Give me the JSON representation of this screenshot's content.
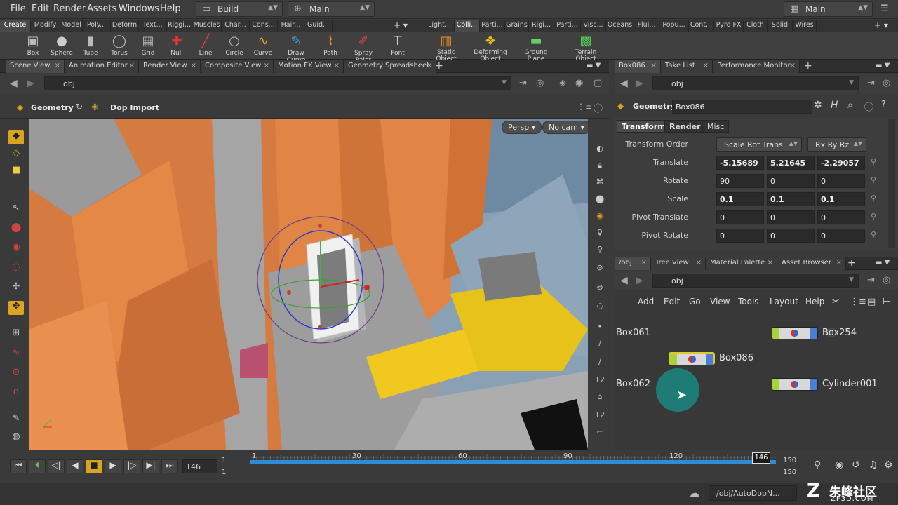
{
  "menubar": {
    "items": [
      "File",
      "Edit",
      "Render",
      "Assets",
      "Windows",
      "Help"
    ],
    "desktop_left": "Build",
    "desktop_mid": "Main",
    "desktop_right": "Main"
  },
  "shelf_tabs_left": [
    "Create",
    "Modify",
    "Model",
    "Poly...",
    "Deform",
    "Text...",
    "Riggi...",
    "Muscles",
    "Char...",
    "Cons...",
    "Hair...",
    "Guid..."
  ],
  "shelf_tabs_right": [
    "Light...",
    "Colli...",
    "Parti...",
    "Grains",
    "Rigi...",
    "Parti...",
    "Visc...",
    "Oceans",
    "Flui...",
    "Popu...",
    "Cont...",
    "Pyro FX",
    "Cloth",
    "Solid",
    "Wires"
  ],
  "shelf_tools_left": [
    {
      "label": "Box",
      "icon": "cube"
    },
    {
      "label": "Sphere",
      "icon": "sphere"
    },
    {
      "label": "Tube",
      "icon": "tube"
    },
    {
      "label": "Torus",
      "icon": "torus"
    },
    {
      "label": "Grid",
      "icon": "grid"
    },
    {
      "label": "Null",
      "icon": "null"
    },
    {
      "label": "Line",
      "icon": "line"
    },
    {
      "label": "Circle",
      "icon": "circle"
    },
    {
      "label": "Curve",
      "icon": "curve"
    },
    {
      "label": "Draw Curve",
      "icon": "draw-curve"
    },
    {
      "label": "Path",
      "icon": "path"
    },
    {
      "label": "Spray Paint",
      "icon": "spray"
    },
    {
      "label": "Font",
      "icon": "font"
    }
  ],
  "shelf_tools_right": [
    {
      "label": "Static Object",
      "icon": "static"
    },
    {
      "label": "Deforming Object",
      "icon": "deforming"
    },
    {
      "label": "Ground Plane",
      "icon": "ground"
    },
    {
      "label": "Terrain Object",
      "icon": "terrain"
    }
  ],
  "left_pane_tabs": [
    "Scene View",
    "Animation Editor",
    "Render View",
    "Composite View",
    "Motion FX View",
    "Geometry Spreadsheet"
  ],
  "left_path": "obj",
  "viewer_context": "Geometry",
  "viewer_tool": "Dop Import",
  "viewport_buttons": {
    "persp": "Persp",
    "cam": "No cam"
  },
  "right_top_tabs": [
    "Box086",
    "Take List",
    "Performance Monitor"
  ],
  "right_path": "obj",
  "node_type": "Geometry",
  "node_name": "Box086",
  "param_tabs": [
    "Transform",
    "Render",
    "Misc"
  ],
  "params": {
    "transform_order": {
      "label": "Transform Order",
      "value1": "Scale Rot Trans",
      "value2": "Rx Ry Rz"
    },
    "rows": [
      {
        "label": "Translate",
        "values": [
          "-5.15689",
          "5.21645",
          "-2.29057"
        ],
        "bold": true
      },
      {
        "label": "Rotate",
        "values": [
          "90",
          "0",
          "0"
        ],
        "bold": false
      },
      {
        "label": "Scale",
        "values": [
          "0.1",
          "0.1",
          "0.1"
        ],
        "bold": true
      },
      {
        "label": "Pivot Translate",
        "values": [
          "0",
          "0",
          "0"
        ],
        "bold": false
      },
      {
        "label": "Pivot Rotate",
        "values": [
          "0",
          "0",
          "0"
        ],
        "bold": false
      }
    ]
  },
  "network_tabs": [
    "/obj",
    "Tree View",
    "Material Palette",
    "Asset Browser"
  ],
  "network_path": "obj",
  "network_menu": [
    "Add",
    "Edit",
    "Go",
    "View",
    "Tools",
    "Layout",
    "Help"
  ],
  "nodes": {
    "box061": "Box061",
    "box062": "Box062",
    "box086": "Box086",
    "box254": "Box254",
    "cylinder": "Cylinder001"
  },
  "timeline": {
    "frame": "146",
    "start": "1",
    "start2": "1",
    "end": "150",
    "end2": "150",
    "ticks": [
      "1",
      "30",
      "60",
      "90",
      "120"
    ],
    "current_marker": "146"
  },
  "status": {
    "path": "/obj/AutoDopN..."
  },
  "watermark": {
    "text": "朱峰社区",
    "sub": "ZF3D.COM"
  },
  "colors": {
    "accent": "#d9a520",
    "timeline_bar": "#2e8bd6",
    "node_green": "#a9d33a",
    "node_blue": "#4a7fd6"
  }
}
